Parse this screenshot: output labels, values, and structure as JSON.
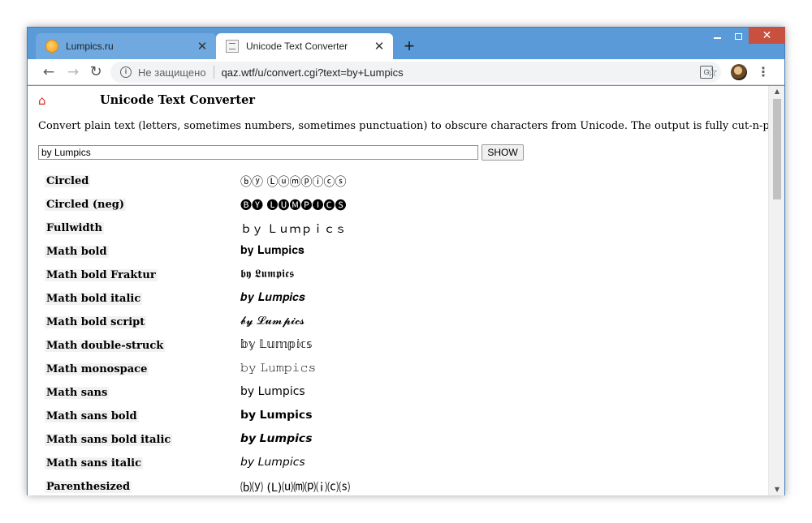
{
  "tabs": [
    {
      "title": "Lumpics.ru",
      "close": "✕",
      "icon": "orange-circle-icon"
    },
    {
      "title": "Unicode Text Converter",
      "close": "✕",
      "icon": "page-icon"
    }
  ],
  "new_tab": "+",
  "window_controls": {
    "close": "✕"
  },
  "nav": {
    "back": "←",
    "forward": "→",
    "reload": "↻"
  },
  "omnibox": {
    "security_label": "Не защищено",
    "url": "qaz.wtf/u/convert.cgi?text=by+Lumpics"
  },
  "toolbar_icons": {
    "star": "☆",
    "menu": "⋮",
    "translate": "G"
  },
  "page": {
    "home_icon": "⌂",
    "title": "Unicode Text Converter",
    "description": "Convert plain text (letters, sometimes numbers, sometimes punctuation) to obscure characters from Unicode. The output is fully cut-n-pastable text.",
    "input_value": "by Lumpics",
    "show_label": "SHOW"
  },
  "results": [
    {
      "label": "Circled",
      "value": "ⓑⓨ Ⓛⓤⓜⓟⓘⓒⓢ"
    },
    {
      "label": "Circled (neg)",
      "value": "🅑🅨 🅛🅤🅜🅟🅘🅒🅢"
    },
    {
      "label": "Fullwidth",
      "value": "ｂｙ Ｌｕｍｐｉｃｓ"
    },
    {
      "label": "Math bold",
      "value": "𝐛𝐲 𝐋𝐮𝐦𝐩𝐢𝐜𝐬"
    },
    {
      "label": "Math bold Fraktur",
      "value": "𝖇𝖞 𝕷𝖚𝖒𝖕𝖎𝖈𝖘"
    },
    {
      "label": "Math bold italic",
      "value": "𝒃𝒚 𝑳𝒖𝒎𝒑𝒊𝒄𝒔"
    },
    {
      "label": "Math bold script",
      "value": "𝓫𝔂 𝓛𝓾𝓶𝓹𝓲𝓬𝓼"
    },
    {
      "label": "Math double-struck",
      "value": "𝕓𝕪 𝕃𝕦𝕞𝕡𝕚𝕔𝕤"
    },
    {
      "label": "Math monospace",
      "value": "𝚋𝚢 𝙻𝚞𝚖𝚙𝚒𝚌𝚜"
    },
    {
      "label": "Math sans",
      "value": "𝖻𝗒 𝖫𝗎𝗆𝗉𝗂𝖼𝗌"
    },
    {
      "label": "Math sans bold",
      "value": "𝗯𝘆 𝗟𝘂𝗺𝗽𝗶𝗰𝘀"
    },
    {
      "label": "Math sans bold italic",
      "value": "𝙗𝙮 𝙇𝙪𝙢𝙥𝙞𝙘𝙨"
    },
    {
      "label": "Math sans italic",
      "value": "𝘣𝘺 𝘓𝘶𝘮𝘱𝘪𝘤𝘴"
    },
    {
      "label": "Parenthesized",
      "value": "⒝⒴ (L)⒰⒨⒫⒤⒞⒮"
    }
  ]
}
